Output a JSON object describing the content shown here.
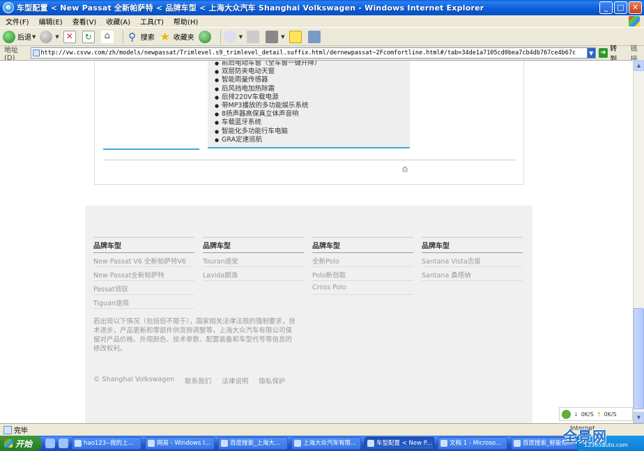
{
  "window": {
    "title": "车型配置 < New Passat 全新帕萨特 < 品牌车型 < 上海大众汽车 Shanghai Volkswagen - Windows Internet Explorer",
    "minimize": "_",
    "maximize": "□",
    "close": "✕"
  },
  "menu": [
    "文件(F)",
    "编辑(E)",
    "查看(V)",
    "收藏(A)",
    "工具(T)",
    "帮助(H)"
  ],
  "toolbar": {
    "back_label": "后退",
    "search_label": "搜索",
    "favorites_label": "收藏夹"
  },
  "address": {
    "label": "地址(D)",
    "url": "http://vw.csvw.com/zh/models/newpassat/Trimlevel.s9_trimlevel_detail.suffix.html/dernewpassat~2Fcomfortline.html#/tab=34de1a7105cd0bea7cb4db767ce4b67c",
    "go_label": "转到",
    "links_label": "链接"
  },
  "features": [
    "前后电动车窗（全车窗一键升降）",
    "双层防夹电动天窗",
    "智能雨量传感器",
    "后风挡电加热除霜",
    "后排220V车载电源",
    "带MP3播放的多功能娱乐系统",
    "8扬声器高保真立体声音响",
    "车载蓝牙系统",
    "智能化多功能行车电脑",
    "GRA定速巡航"
  ],
  "footer": {
    "columns": [
      {
        "heading": "品牌车型",
        "links": [
          "New Passat V6 全新帕萨特V6",
          "New Passat全新帕萨特",
          "Passat领驭",
          "Tiguan途观"
        ]
      },
      {
        "heading": "品牌车型",
        "links": [
          "Touran途安",
          "Lavida朗逸"
        ]
      },
      {
        "heading": "品牌车型",
        "links": [
          "全新Polo",
          "Polo新劲取",
          "Cross Polo"
        ]
      },
      {
        "heading": "品牌车型",
        "links": [
          "Santana Vista志俊",
          "Santana 桑塔纳"
        ]
      }
    ],
    "disclaimer": "若出现以下情况（包括但不限于），国家相关法律法规的强制要求，技术进步，产品更新和零部件供货商调整等，上海大众汽车有限公司保留对产品价格、外观颜色、技术参数、配置装备和车型代号等信息的修改权利。",
    "copyright": "© Shanghai Volkswagen",
    "contact": "联系我们",
    "legal": "法律说明",
    "privacy": "隐私保护"
  },
  "widget": {
    "down": "0K/S",
    "up": "0K/S"
  },
  "status": {
    "text": "完毕",
    "zone": "Internet"
  },
  "taskbar": {
    "start": "开始",
    "tasks": [
      "hao123--我的上...",
      "网易 - Windows I...",
      "百度搜索_上海大...",
      "上海大众汽车有限...",
      "车型配置 < New P...",
      "文档 1 - Microso...",
      "百度搜索_智能化..."
    ],
    "active_task": 4
  },
  "watermark": {
    "brand": "全景网",
    "site": "12365auto.com"
  },
  "colors": {
    "accent": "#3fa9d8",
    "titlebar": "#0b5fd6",
    "taskbar": "#2458c8",
    "start": "#2f8a2f"
  }
}
